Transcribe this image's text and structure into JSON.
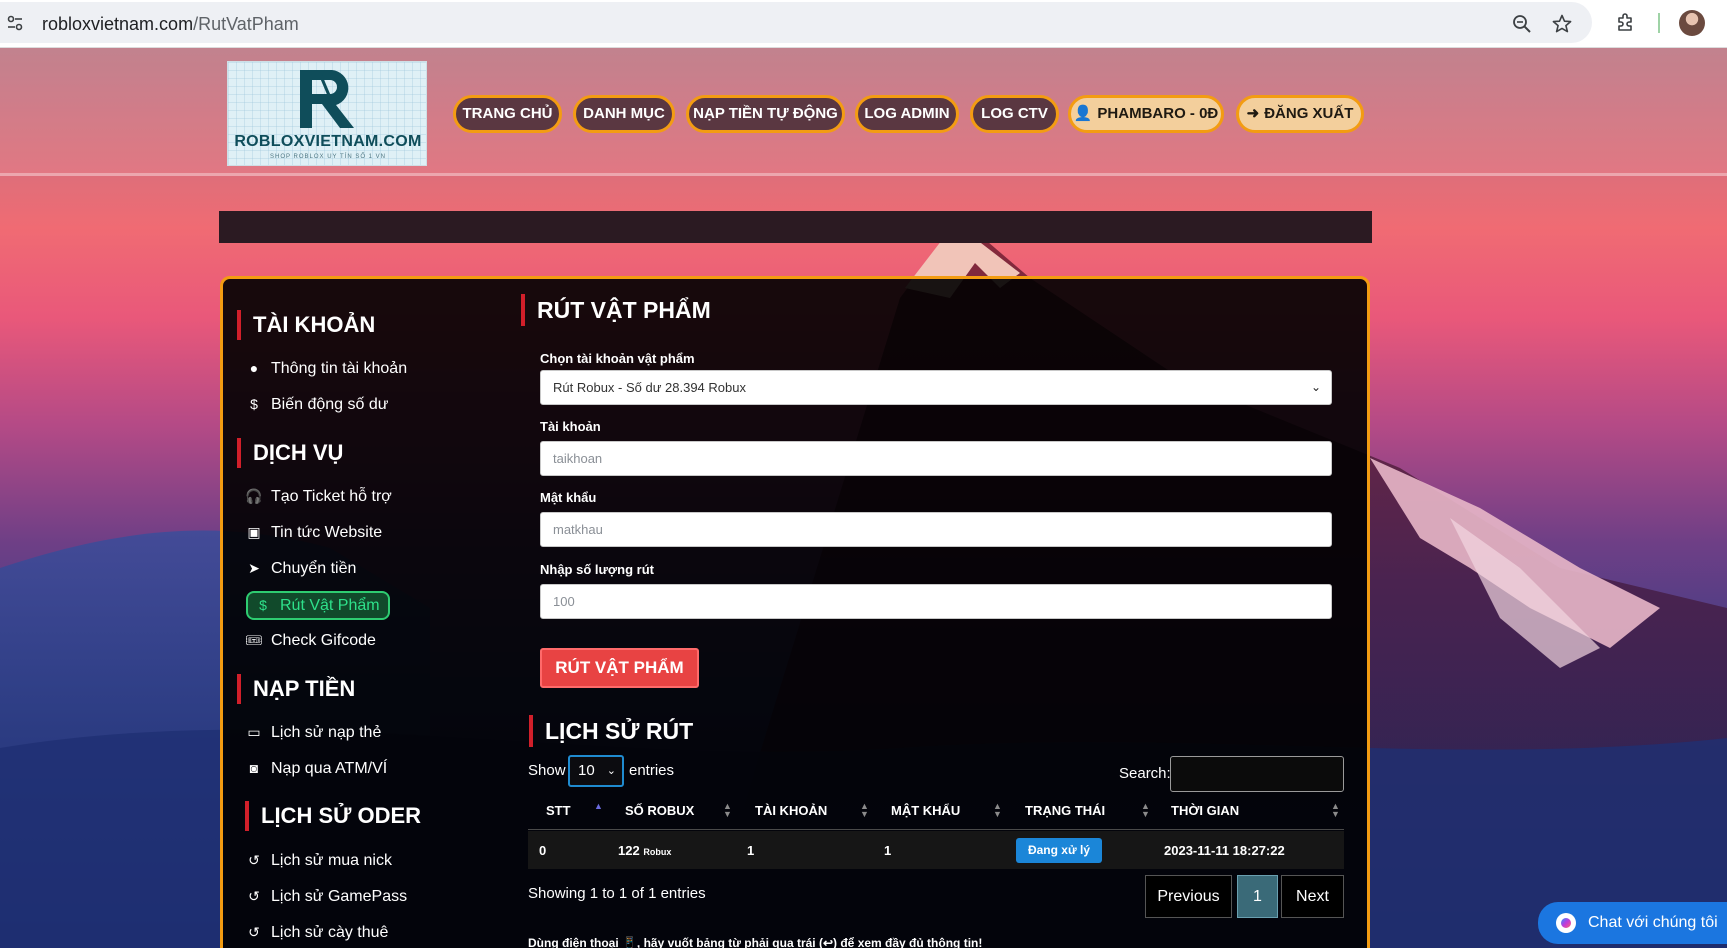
{
  "browser": {
    "url_host": "robloxvietnam.com",
    "url_path": "/RutVatPham"
  },
  "header": {
    "logo_text": "ROBLOXVIETNAM.COM",
    "logo_sub": "SHOP ROBLOX UY TÍN SỐ 1 VN",
    "nav": {
      "home": "TRANG CHỦ",
      "category": "DANH MỤC",
      "auto_topup": "NẠP TIỀN TỰ ĐỘNG",
      "log_admin": "LOG ADMIN",
      "log_ctv": "LOG CTV",
      "user": "PHAMBARO - 0Đ",
      "logout": "ĐĂNG XUẤT"
    }
  },
  "sidebar": {
    "account_heading": "TÀI KHOẢN",
    "account_items": [
      "Thông tin tài khoản",
      "Biến động số dư"
    ],
    "service_heading": "DỊCH VỤ",
    "service_items": [
      "Tạo Ticket hỗ trợ",
      "Tin tức Website",
      "Chuyển tiền",
      "Rút Vật Phẩm",
      "Check Gifcode"
    ],
    "topup_heading": "NẠP TIỀN",
    "topup_items": [
      "Lịch sử nạp thẻ",
      "Nạp qua ATM/VÍ"
    ],
    "order_heading": "LỊCH SỬ ODER",
    "order_items": [
      "Lịch sử mua nick",
      "Lịch sử GamePass",
      "Lịch sử cày thuê"
    ]
  },
  "form": {
    "title": "RÚT VẬT PHẨM",
    "select_label": "Chọn tài khoản vật phẩm",
    "select_value": "Rút Robux - Số dư 28.394 Robux",
    "account_label": "Tài khoản",
    "account_placeholder": "taikhoan",
    "password_label": "Mật khẩu",
    "password_placeholder": "matkhau",
    "amount_label": "Nhập số lượng rút",
    "amount_placeholder": "100",
    "submit_label": "RÚT VẬT PHẨM"
  },
  "history": {
    "title": "LỊCH SỬ RÚT",
    "show_label": "Show",
    "entries_label": "entries",
    "length_value": "10",
    "search_label": "Search:",
    "columns": [
      "STT",
      "SỐ ROBUX",
      "TÀI KHOẢN",
      "MẬT KHẨU",
      "TRẠNG THÁI",
      "THỜI GIAN"
    ],
    "rows": [
      {
        "stt": "0",
        "robux": "122",
        "robux_unit": "Robux",
        "account": "1",
        "password": "1",
        "status": "Đang xử lý",
        "time": "2023-11-11 18:27:22"
      }
    ],
    "info": "Showing 1 to 1 of 1 entries",
    "prev_label": "Previous",
    "page_label": "1",
    "next_label": "Next",
    "mobile_note": "Dùng điện thoại 📱, hãy vuốt bảng từ phải qua trái (↩) để xem đầy đủ thông tin!"
  },
  "chat": {
    "label": "Chat với chúng tôi"
  },
  "colors": {
    "accent_orange": "#f39c12",
    "danger_red": "#e84343",
    "status_blue": "#1b86d8",
    "active_green": "#2ecc71"
  }
}
